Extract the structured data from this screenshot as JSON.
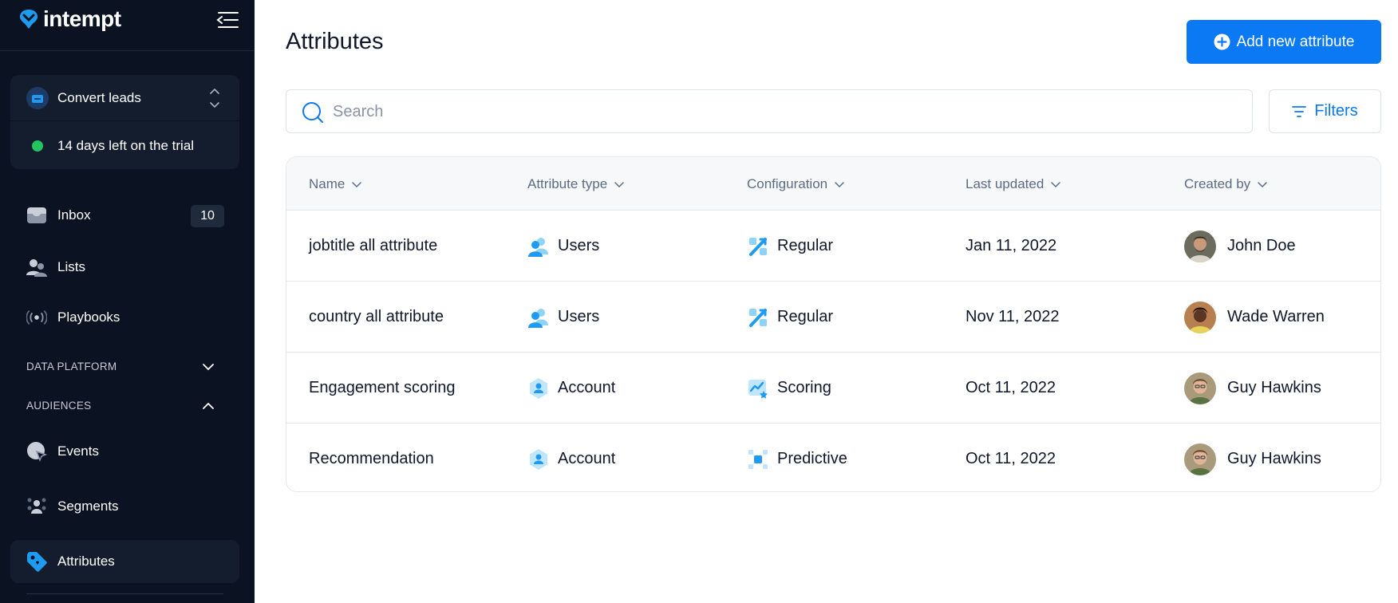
{
  "brand": {
    "name": "intempt"
  },
  "workspace": {
    "name": "Convert leads",
    "trial_text": "14 days left on the trial"
  },
  "nav": {
    "inbox": {
      "label": "Inbox",
      "badge": "10"
    },
    "lists": {
      "label": "Lists"
    },
    "playbooks": {
      "label": "Playbooks"
    },
    "data_platform": {
      "label": "DATA PLATFORM",
      "expanded": false
    },
    "audiences": {
      "label": "AUDIENCES",
      "expanded": true
    },
    "events": {
      "label": "Events"
    },
    "segments": {
      "label": "Segments"
    },
    "attributes": {
      "label": "Attributes",
      "active": true
    }
  },
  "page": {
    "title": "Attributes",
    "add_button": "Add new attribute",
    "search_placeholder": "Search",
    "filters_button": "Filters"
  },
  "table": {
    "columns": [
      "Name",
      "Attribute type",
      "Configuration",
      "Last updated",
      "Created by"
    ],
    "rows": [
      {
        "name": "jobtitle all attribute",
        "type": "Users",
        "type_icon": "users-icon",
        "config": "Regular",
        "config_icon": "regular-icon",
        "updated": "Jan 11, 2022",
        "creator": "John Doe"
      },
      {
        "name": "country all attribute",
        "type": "Users",
        "type_icon": "users-icon",
        "config": "Regular",
        "config_icon": "regular-icon",
        "updated": "Nov 11, 2022",
        "creator": "Wade Warren"
      },
      {
        "name": "Engagement scoring",
        "type": "Account",
        "type_icon": "account-icon",
        "config": "Scoring",
        "config_icon": "scoring-icon",
        "updated": "Oct 11, 2022",
        "creator": "Guy Hawkins"
      },
      {
        "name": "Recommendation",
        "type": "Account",
        "type_icon": "account-icon",
        "config": "Predictive",
        "config_icon": "predictive-icon",
        "updated": "Oct 11, 2022",
        "creator": "Guy Hawkins"
      }
    ]
  },
  "colors": {
    "sidebar_bg": "#0b1322",
    "accent": "#0b78f4",
    "trial_dot": "#22c55e"
  }
}
